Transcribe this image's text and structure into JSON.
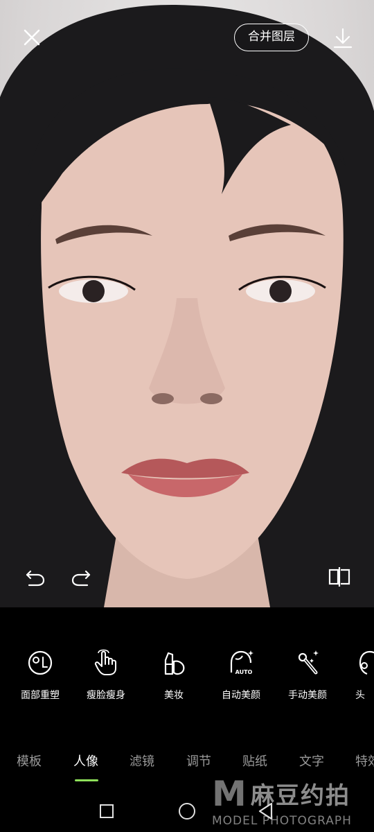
{
  "top_bar": {
    "close_icon": "close-icon",
    "merge_layers_label": "合并图层",
    "download_icon": "download-icon"
  },
  "photo_controls": {
    "undo_icon": "undo-icon",
    "redo_icon": "redo-icon",
    "compare_icon": "compare-icon"
  },
  "tools": [
    {
      "label": "面部重塑",
      "icon": "face-reshape-icon"
    },
    {
      "label": "瘦脸瘦身",
      "icon": "slim-hand-icon"
    },
    {
      "label": "美妆",
      "icon": "makeup-icon"
    },
    {
      "label": "自动美颜",
      "icon": "auto-beauty-icon"
    },
    {
      "label": "手动美颜",
      "icon": "magic-wand-icon"
    },
    {
      "label": "头",
      "icon": "hair-icon"
    }
  ],
  "tabs": [
    {
      "label": "模板",
      "active": false
    },
    {
      "label": "人像",
      "active": true
    },
    {
      "label": "滤镜",
      "active": false
    },
    {
      "label": "调节",
      "active": false
    },
    {
      "label": "贴纸",
      "active": false
    },
    {
      "label": "文字",
      "active": false
    },
    {
      "label": "特效",
      "active": false
    }
  ],
  "watermark": {
    "cn": "麻豆约拍",
    "en": "MODEL PHOTOGRAPH"
  },
  "colors": {
    "accent": "#8ee05a",
    "background": "#000000",
    "inactive_tab": "#9a9a9a"
  }
}
